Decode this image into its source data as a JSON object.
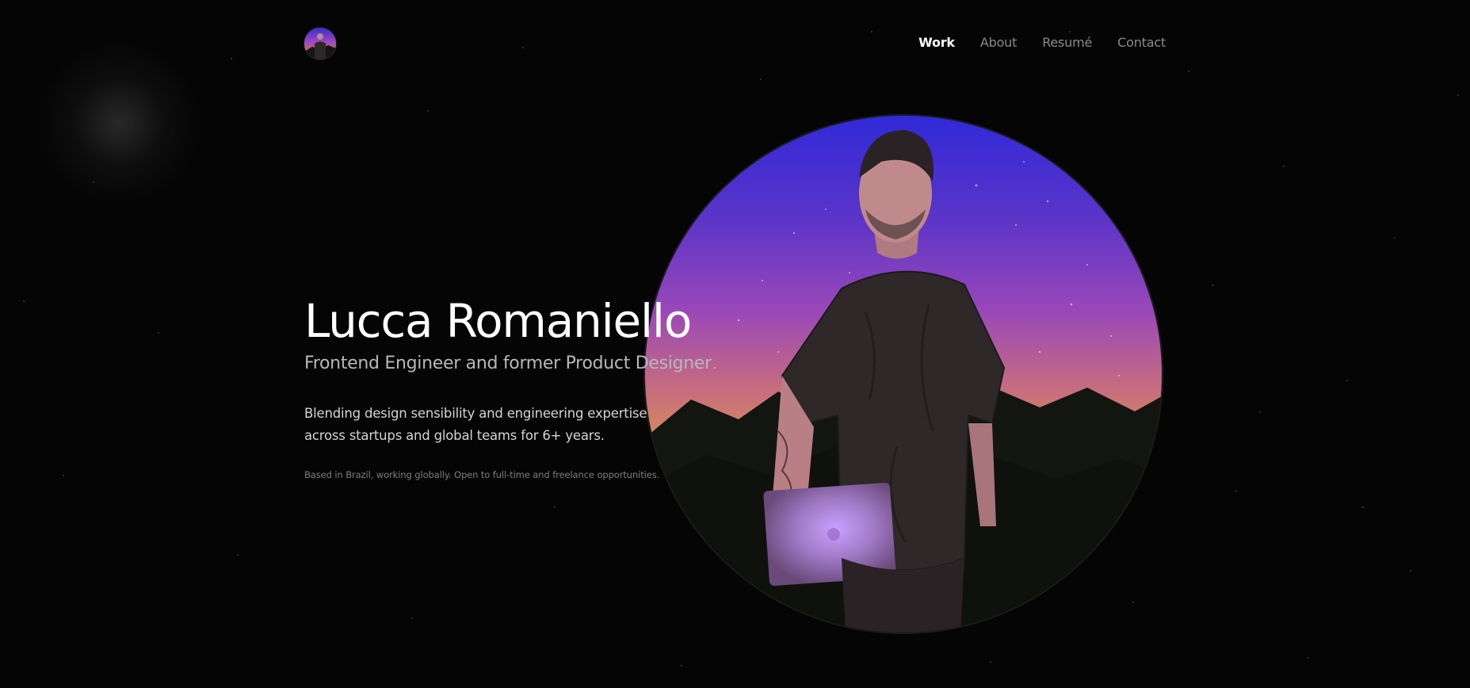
{
  "header": {
    "logo_alt": "Lucca Romaniello avatar",
    "nav": [
      {
        "label": "Work",
        "active": true
      },
      {
        "label": "About",
        "active": false
      },
      {
        "label": "Resumé",
        "active": false
      },
      {
        "label": "Contact",
        "active": false
      }
    ]
  },
  "hero": {
    "title": "Lucca Romaniello",
    "subtitle": "Frontend Engineer and former Product Designer",
    "description": "Blending design sensibility and engineering expertise across startups and global teams for 6+ years.",
    "note": "Based in Brazil, working globally. Open to full-time and freelance opportunities.",
    "portrait_alt": "Illustrated portrait of a man holding a laptop under a purple night sky"
  },
  "colors": {
    "background": "#050505",
    "text_primary": "#ffffff",
    "text_muted": "#8a8a8a",
    "sky_top": "#3b2ad0",
    "sky_mid": "#9a4ac0",
    "sky_horizon": "#d07a5a"
  }
}
